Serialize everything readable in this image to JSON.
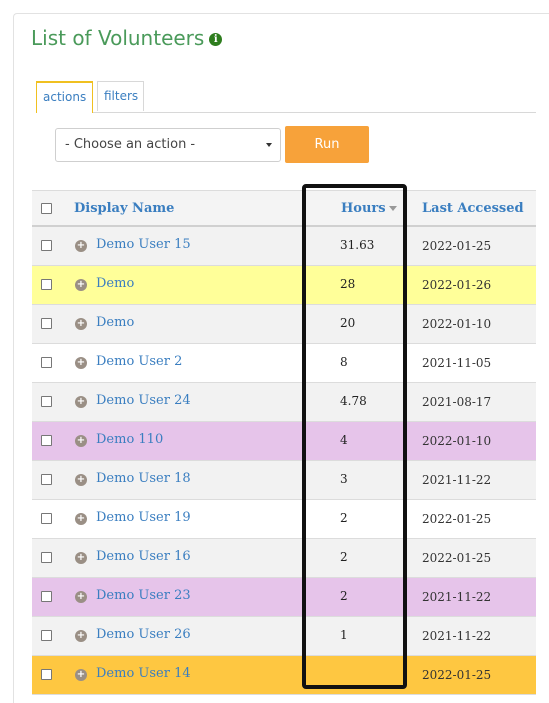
{
  "page": {
    "title": "List of Volunteers",
    "info_icon": "info-icon"
  },
  "tabs": [
    {
      "label": "actions",
      "active": true
    },
    {
      "label": "filters",
      "active": false
    }
  ],
  "action_bar": {
    "select_value": "- Choose an action -",
    "run_label": "Run",
    "run_color": "#f7a23a"
  },
  "table": {
    "headers": {
      "name": "Display Name",
      "hours": "Hours",
      "last": "Last Accessed"
    },
    "rows": [
      {
        "name": "Demo User 15",
        "hours": "31.63",
        "date": "2022-01-25",
        "bg": "#f2f2f2"
      },
      {
        "name": "Demo",
        "hours": "28",
        "date": "2022-01-26",
        "bg": "#ffff99"
      },
      {
        "name": "Demo",
        "hours": "20",
        "date": "2022-01-10",
        "bg": "#f2f2f2"
      },
      {
        "name": "Demo User 2",
        "hours": "8",
        "date": "2021-11-05",
        "bg": "#ffffff"
      },
      {
        "name": "Demo User 24",
        "hours": "4.78",
        "date": "2021-08-17",
        "bg": "#f2f2f2"
      },
      {
        "name": "Demo 110",
        "hours": "4",
        "date": "2022-01-10",
        "bg": "#e6c4ea"
      },
      {
        "name": "Demo User 18",
        "hours": "3",
        "date": "2021-11-22",
        "bg": "#f2f2f2"
      },
      {
        "name": "Demo User 19",
        "hours": "2",
        "date": "2022-01-25",
        "bg": "#ffffff"
      },
      {
        "name": "Demo User 16",
        "hours": "2",
        "date": "2022-01-25",
        "bg": "#f2f2f2"
      },
      {
        "name": "Demo User 23",
        "hours": "2",
        "date": "2021-11-22",
        "bg": "#e6c4ea"
      },
      {
        "name": "Demo User 26",
        "hours": "1",
        "date": "2021-11-22",
        "bg": "#f2f2f2"
      },
      {
        "name": "Demo User 14",
        "hours": "",
        "date": "2022-01-25",
        "bg": "#fec741"
      }
    ]
  }
}
